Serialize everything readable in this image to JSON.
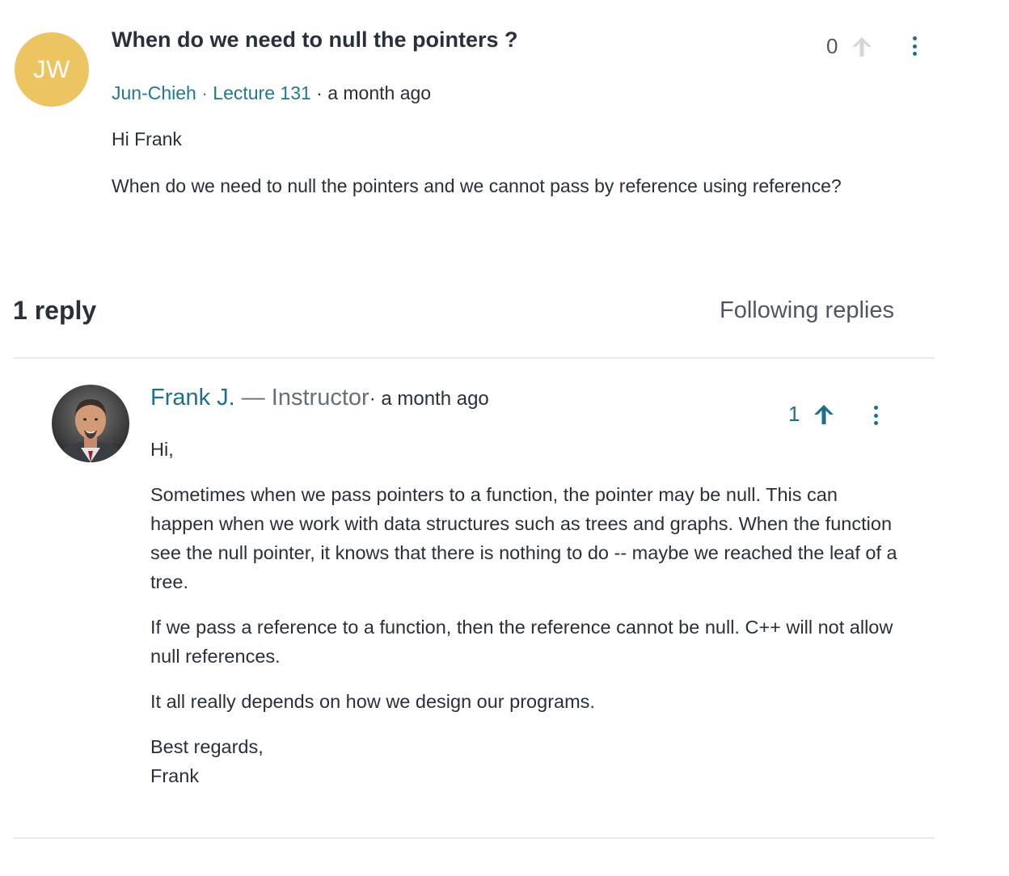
{
  "question": {
    "avatar_initials": "JW",
    "avatar_color": "#ecc462",
    "title": "When do we need to null the pointers ?",
    "author": "Jun-Chieh",
    "meta_separator": "·",
    "lecture": "Lecture 131",
    "time": "· a month ago",
    "body": [
      "Hi Frank",
      "When do we need to null the pointers and we cannot pass by reference using reference?"
    ],
    "votes": "0",
    "upvote_icon": "arrow-up-icon",
    "more_icon": "more-vertical-icon"
  },
  "replies_header": {
    "count_label": "1 reply",
    "following_label": "Following replies"
  },
  "reply": {
    "author": "Frank J.",
    "role": "— Instructor",
    "time": "· a month ago",
    "votes": "1",
    "upvote_icon": "arrow-up-icon",
    "more_icon": "more-vertical-icon",
    "body": [
      "Hi,",
      "Sometimes when we pass pointers to a function, the pointer may be null. This can happen when we work with data structures such as trees and graphs. When the function see the null pointer, it knows that there is nothing to do -- maybe we reached the leaf of a tree.",
      "If we pass a reference to a function, then the reference cannot be null. C++ will not allow null references.",
      "It all really depends on how we design our programs.",
      "Best regards,",
      "Frank"
    ]
  },
  "colors": {
    "accent": "#1f6e8c",
    "text": "#29303b",
    "muted": "#686f7a",
    "divider": "#e8e9eb"
  }
}
